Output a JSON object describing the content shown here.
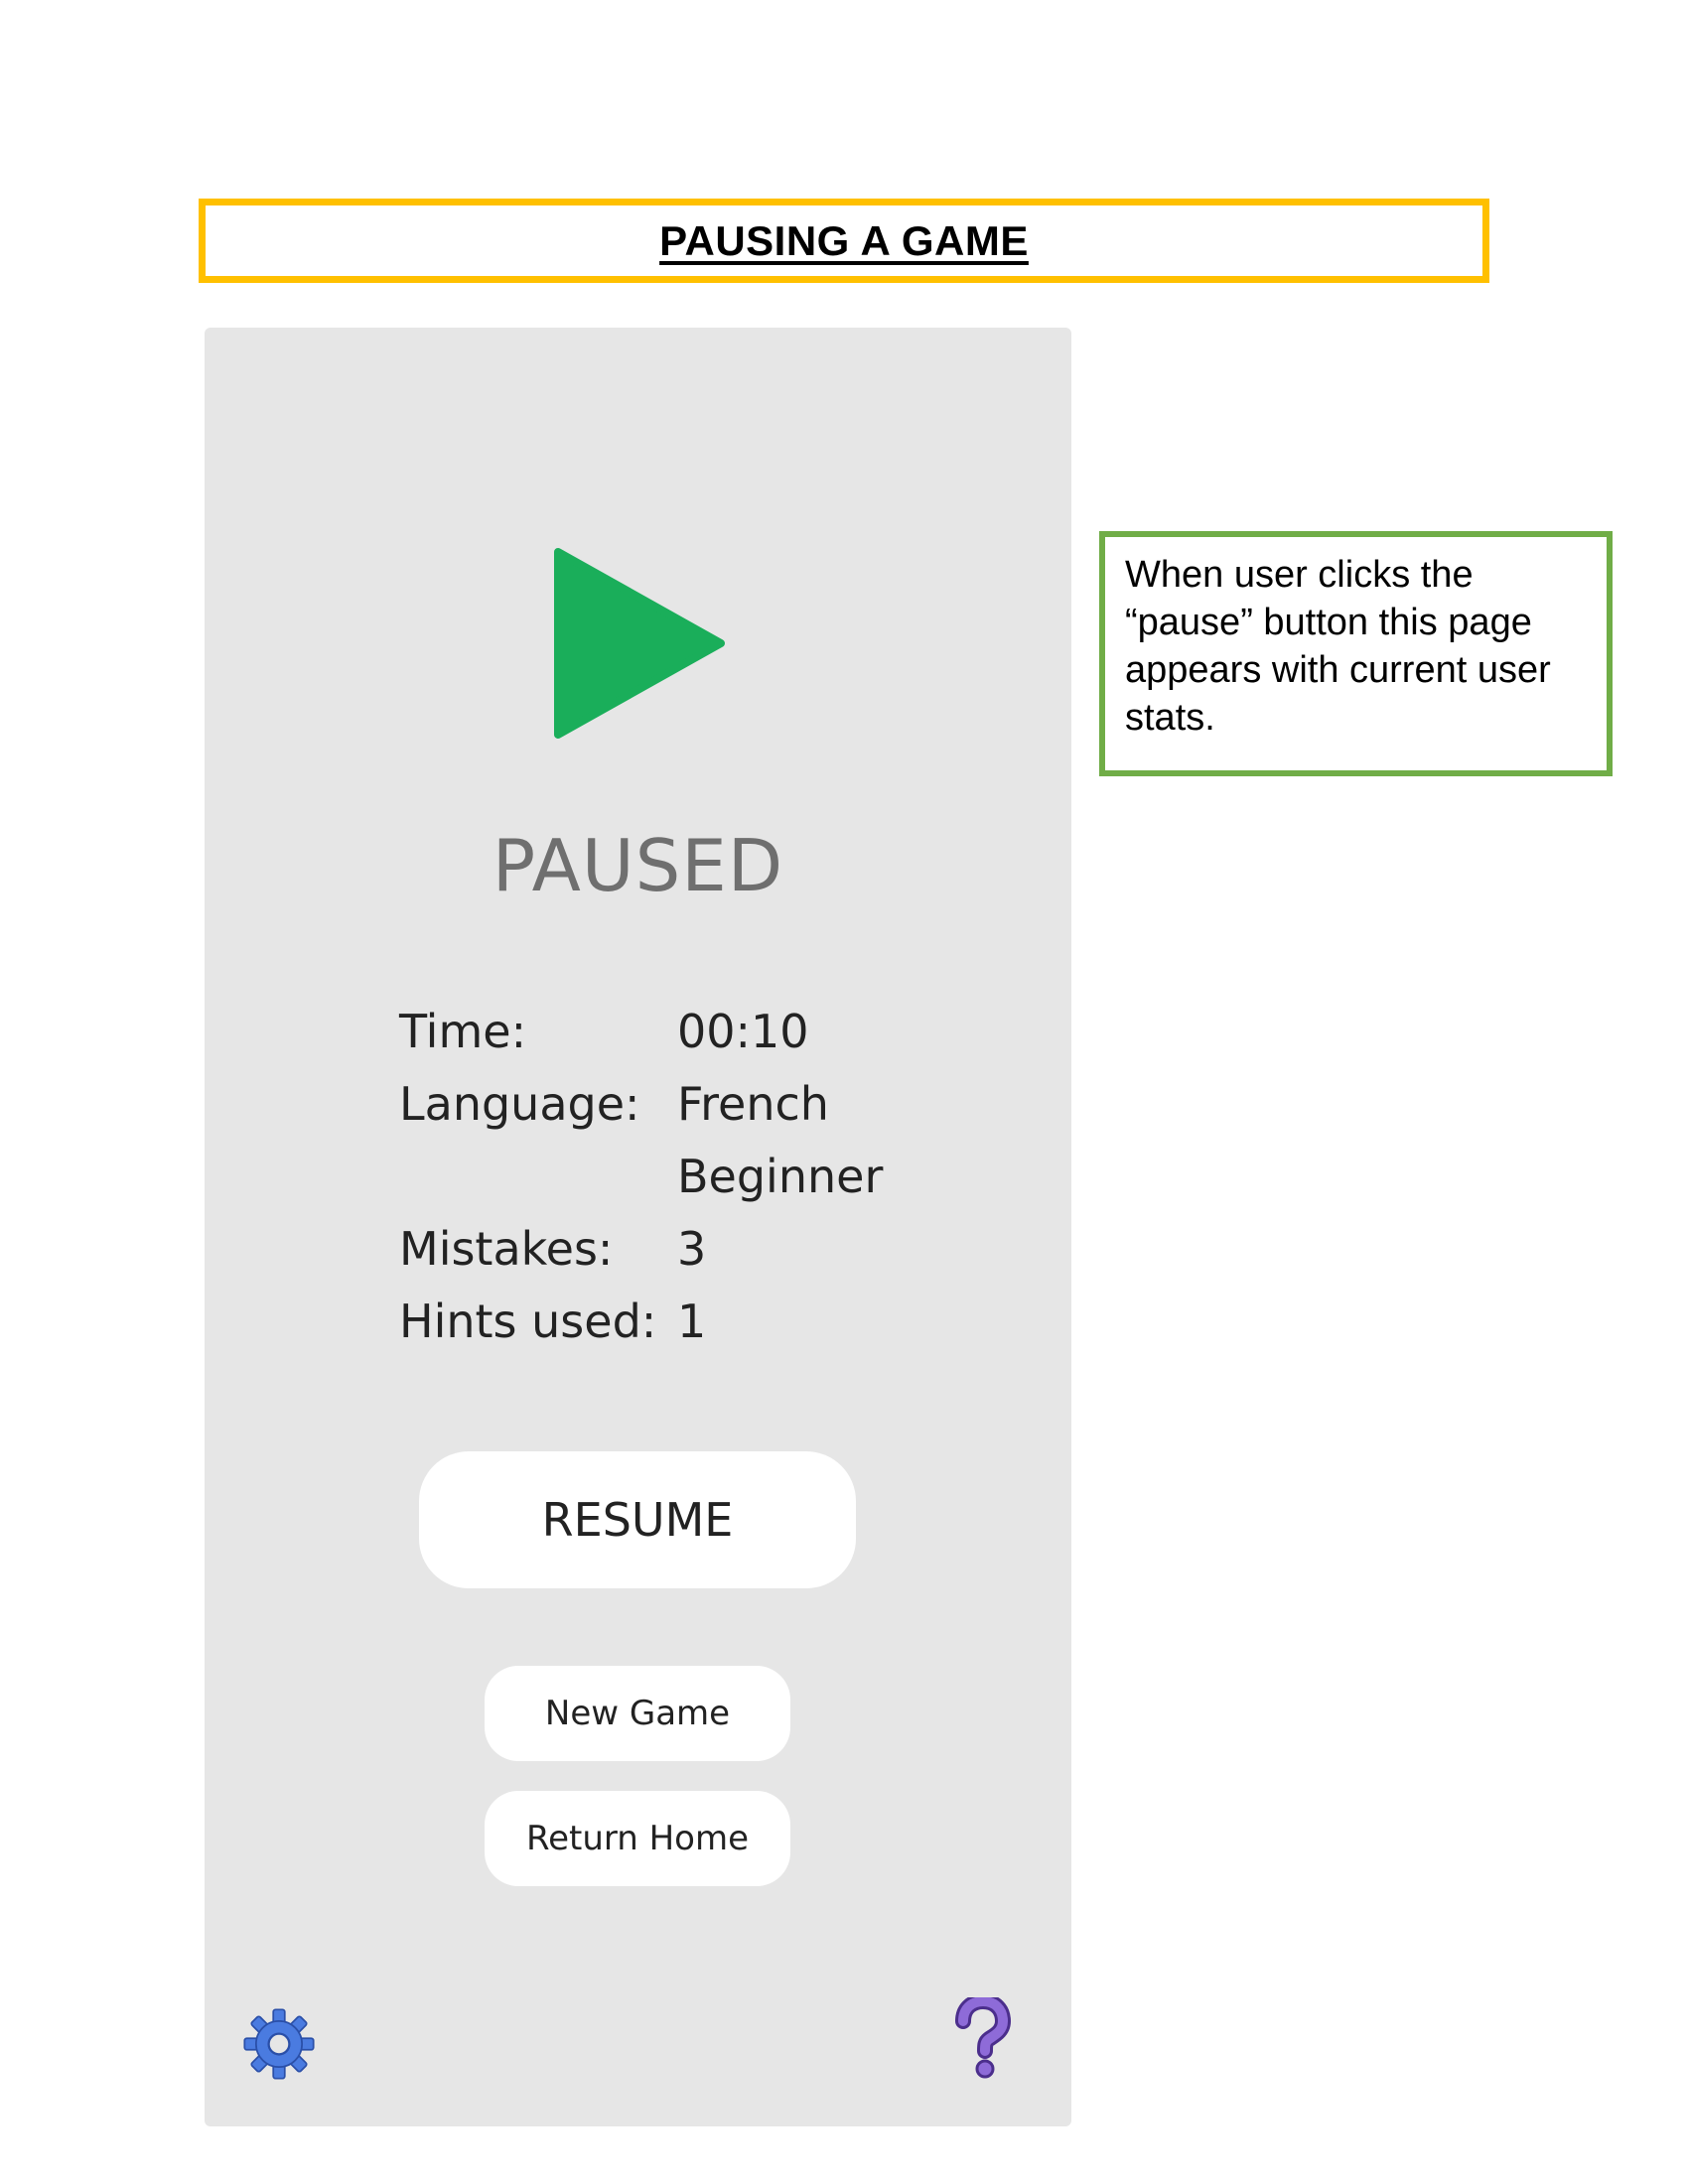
{
  "header": {
    "title": "PAUSING A GAME"
  },
  "app": {
    "play_icon": "play-icon",
    "status_label": "PAUSED",
    "stats": [
      {
        "label": "Time:",
        "value": "00:10"
      },
      {
        "label": "Language:",
        "value": "French"
      },
      {
        "label": "",
        "value": "Beginner"
      },
      {
        "label": "Mistakes:",
        "value": "3"
      },
      {
        "label": "Hints used:",
        "value": "1"
      }
    ],
    "buttons": {
      "resume": "RESUME",
      "new_game": "New Game",
      "return_home": "Return Home"
    },
    "footer": {
      "settings_icon": "gear-icon",
      "help_icon": "help-icon"
    }
  },
  "note": {
    "text": "When user clicks the “pause” button this page appears with current user stats."
  },
  "colors": {
    "title_border": "#FFC000",
    "note_border": "#70AD47",
    "play_green": "#1AAE5A",
    "app_background": "#E6E6E6",
    "gear_blue": "#4A7BE0",
    "help_purple": "#8E6BD8"
  }
}
